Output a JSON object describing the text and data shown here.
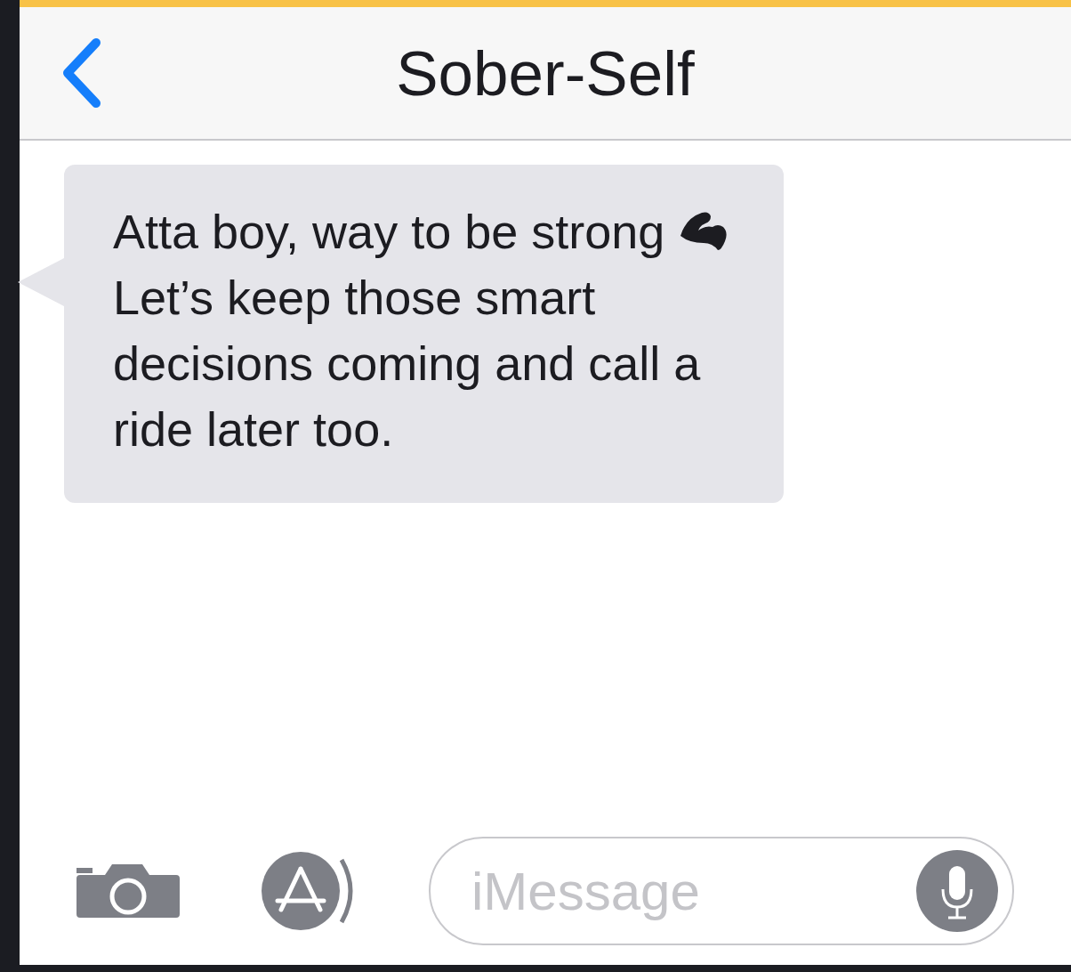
{
  "header": {
    "title": "Sober-Self"
  },
  "messages": [
    {
      "kind": "received",
      "text": "Atta boy, way to be strong",
      "after_icon_text": "Let’s keep those smart decisions coming and call a ride later too."
    }
  ],
  "composer": {
    "placeholder": "iMessage"
  }
}
